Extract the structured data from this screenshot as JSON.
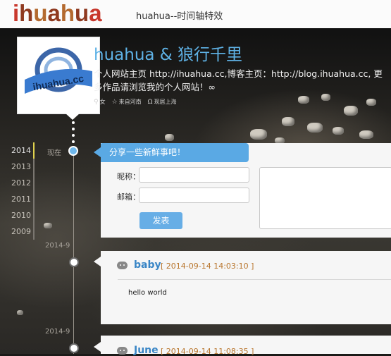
{
  "header": {
    "logo_text": "ihuahua",
    "site_title": "huahua--时间轴特效"
  },
  "profile": {
    "avatar_text": "ihuahua.cc",
    "name": "huahua & 狼行千里",
    "description": "个人网站主页 http://ihuahua.cc,博客主页：http://blog.ihuahua.cc, 更多作品请浏览我的个人网站！∞",
    "meta": [
      {
        "icon": "gender-icon",
        "glyph": "⚲",
        "text": "女"
      },
      {
        "icon": "star-icon",
        "glyph": "☆",
        "text": "来自河南"
      },
      {
        "icon": "location-icon",
        "glyph": "Ω",
        "text": "现居上海"
      }
    ]
  },
  "years": [
    "2014",
    "2013",
    "2012",
    "2011",
    "2010",
    "2009"
  ],
  "active_year": "2014",
  "timeline": {
    "now_label": "现在",
    "date_labels": [
      "2014-9",
      "2014-9"
    ]
  },
  "composer": {
    "title": "分享一些新鲜事吧！",
    "nickname_label": "昵称：",
    "email_label": "邮箱：",
    "submit_label": "发表"
  },
  "posts": [
    {
      "author": "baby",
      "time": "[ 2014-09-14 14:03:10 ]",
      "body": "hello world"
    },
    {
      "author": "June",
      "time": "[ 2014-09-14 11:08:35 ]",
      "body": ""
    }
  ],
  "colors": {
    "accent": "#5aa9e4",
    "author": "#3a86c6",
    "timestamp": "#b8752c",
    "active_year_marker": "#e0d24e"
  }
}
